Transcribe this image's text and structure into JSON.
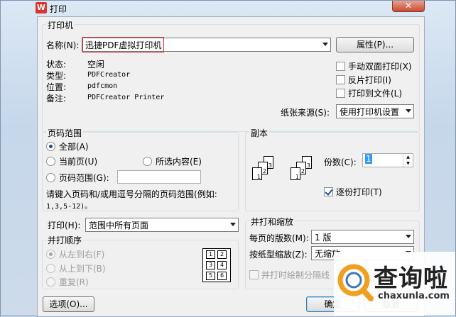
{
  "window": {
    "title": "打印",
    "app_icon": "W",
    "close_glyph": "✕"
  },
  "printer": {
    "group_label": "打印机",
    "name_label": "名称",
    "name_key": "(N):",
    "name_value": "迅捷PDF虚拟打印机",
    "properties_button": "属性(P)...",
    "status_label": "状态:",
    "status_value": "空闲",
    "type_label": "类型:",
    "type_value": "PDFCreator",
    "where_label": "位置:",
    "where_value": "pdfcmon",
    "comment_label": "备注:",
    "comment_value": "PDFCreator Printer",
    "duplex_label": "手动双面打印(X)",
    "duplex_checked": false,
    "reverse_label": "反片打印(I)",
    "reverse_checked": false,
    "to_file_label": "打印到文件(L)",
    "to_file_checked": false,
    "paper_source_label": "纸张来源(S):",
    "paper_source_value": "使用打印机设置"
  },
  "page_range": {
    "group_label": "页码范围",
    "all_label": "全部(A)",
    "current_label": "当前页(U)",
    "selection_label": "所选内容(E)",
    "range_label": "页码范围(G):",
    "range_value": "",
    "hint": "请键入页码和/或用逗号分隔的页码范围(例如:",
    "hint_example": "1,3,5-12)。",
    "selected": "all"
  },
  "copies": {
    "group_label": "副本",
    "count_label": "份数(C):",
    "count_value": "1",
    "collate_label": "逐份打印(T)",
    "collate_checked": true,
    "page_digits": [
      "3",
      "2",
      "1",
      "3",
      "2",
      "1"
    ]
  },
  "print_what": {
    "label": "打印(H):",
    "value": "范围中所有页面",
    "order_label": "并打顺序",
    "left_to_right": "从左到右(F)",
    "top_to_bottom": "从上到下(B)",
    "repeat": "重复(R)",
    "grid_digits": [
      "1",
      "2",
      "3",
      "4",
      "5",
      "6"
    ]
  },
  "zoom": {
    "group_label": "并打和缩放",
    "pages_per_sheet_label": "每页的版数(M):",
    "pages_per_sheet_value": "1 版",
    "scale_label": "按纸型缩放(Z):",
    "scale_value": "无缩放",
    "draw_borders_label": "并打时绘制分隔线"
  },
  "footer": {
    "options_button": "选项(O)...",
    "ok_button": "确定",
    "cancel_button": "取消"
  },
  "watermark": {
    "brand": "查询啦",
    "url": "chaxunla.com"
  },
  "colors": {
    "accent": "#3c7fb1",
    "highlight_box": "#e03030",
    "watermark_orange": "#f0a020"
  }
}
